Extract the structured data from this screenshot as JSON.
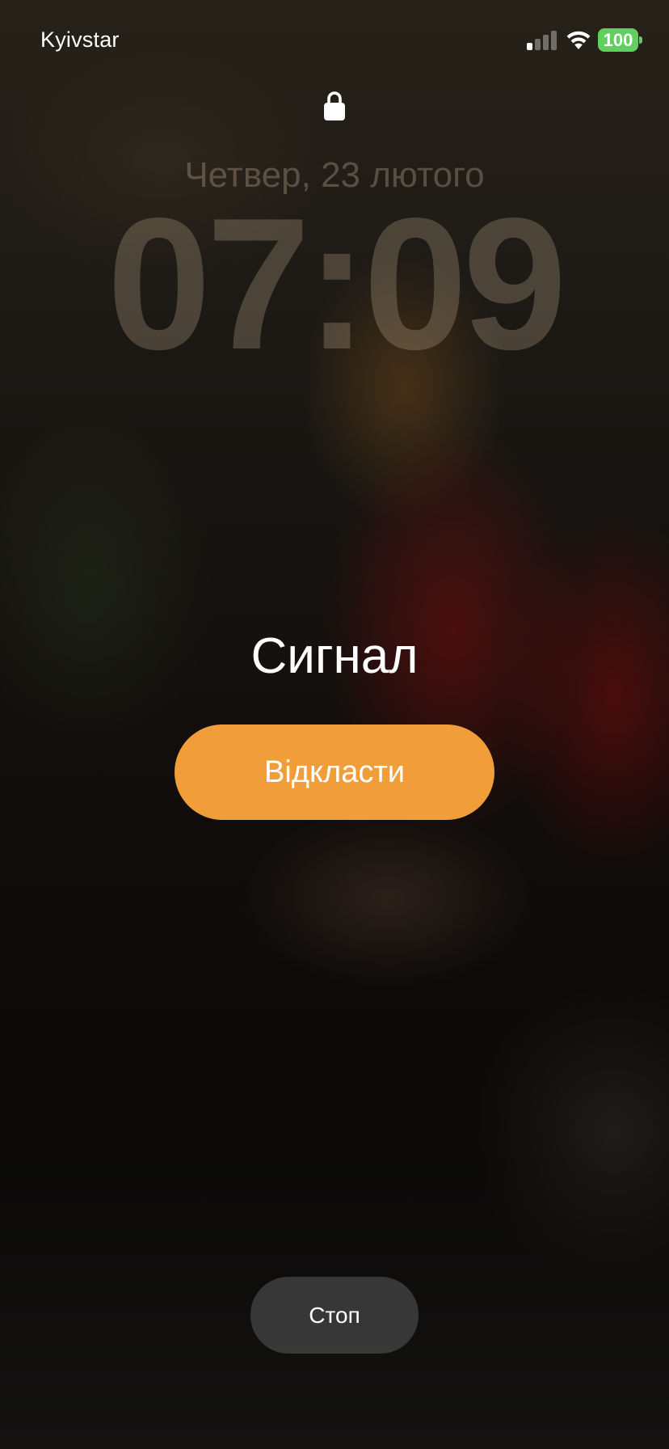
{
  "status_bar": {
    "carrier": "Kyivstar",
    "signal_bars_active": 1,
    "signal_bars_total": 4,
    "wifi_icon": "wifi-icon",
    "battery_level": "100",
    "battery_color": "#5fcf5e"
  },
  "lock_screen": {
    "lock_icon": "lock-icon",
    "date": "Четвер, 23 лютого",
    "time": "07:09"
  },
  "alarm": {
    "label": "Сигнал",
    "snooze_label": "Відкласти",
    "stop_label": "Стоп",
    "accent_color": "#f09d3a"
  }
}
